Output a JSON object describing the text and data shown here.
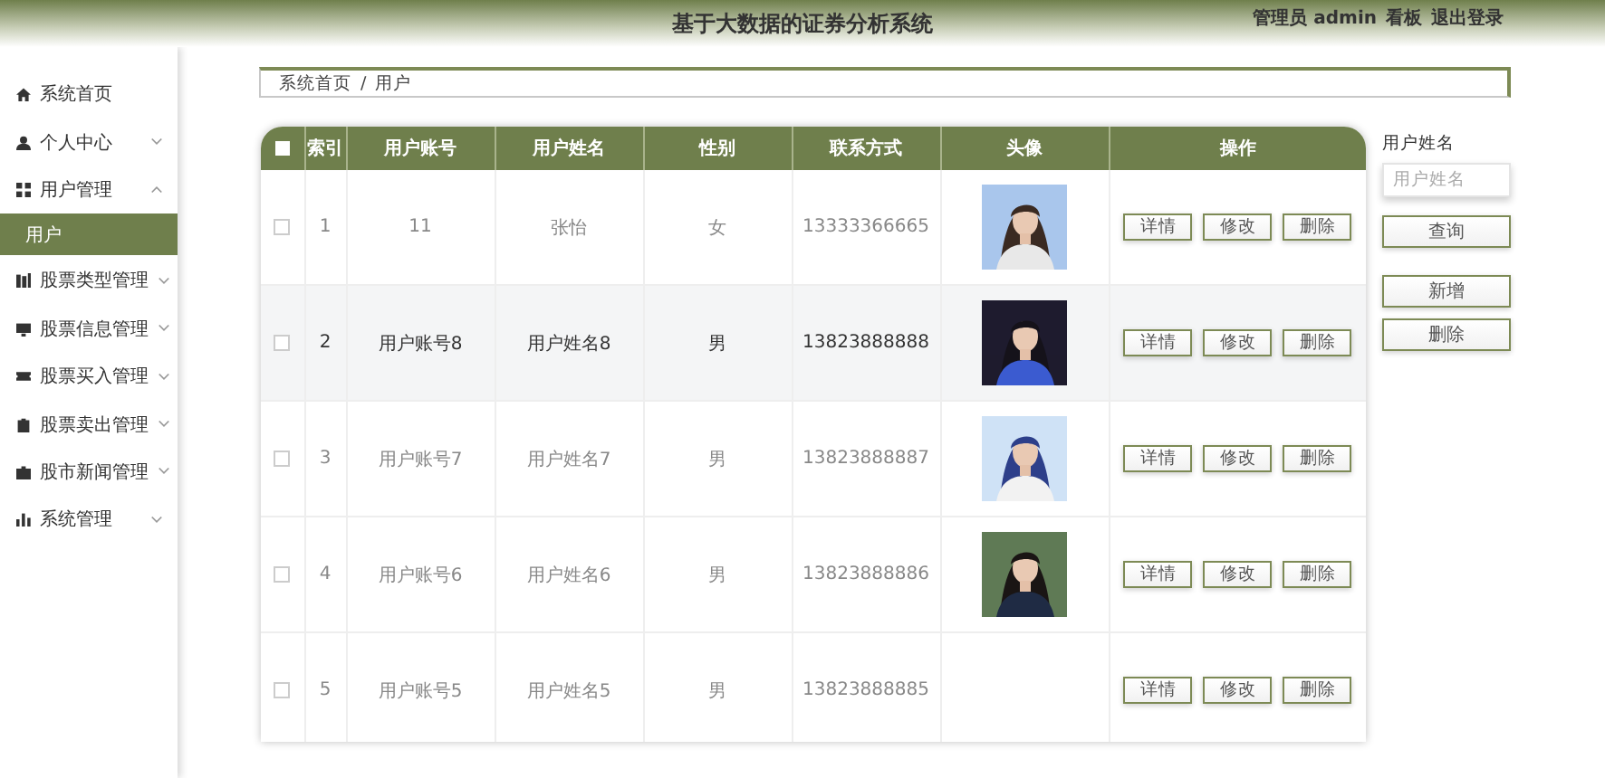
{
  "header": {
    "title": "基于大数据的证券分析系统",
    "links": [
      "管理员 admin",
      "看板",
      "退出登录"
    ]
  },
  "sidebar": {
    "items": [
      {
        "label": "系统首页",
        "kind": "link"
      },
      {
        "label": "个人中心",
        "kind": "group",
        "expanded": false
      },
      {
        "label": "用户管理",
        "kind": "group",
        "expanded": true,
        "children": [
          {
            "label": "用户",
            "selected": true
          }
        ]
      },
      {
        "label": "股票类型管理",
        "kind": "group",
        "expanded": false
      },
      {
        "label": "股票信息管理",
        "kind": "group",
        "expanded": false
      },
      {
        "label": "股票买入管理",
        "kind": "group",
        "expanded": false
      },
      {
        "label": "股票卖出管理",
        "kind": "group",
        "expanded": false
      },
      {
        "label": "股市新闻管理",
        "kind": "group",
        "expanded": false
      },
      {
        "label": "系统管理",
        "kind": "group",
        "expanded": false
      }
    ]
  },
  "breadcrumb": [
    "系统首页",
    "/",
    "用户"
  ],
  "table": {
    "header_checked": false,
    "columns": [
      "索引",
      "用户账号",
      "用户姓名",
      "性别",
      "联系方式",
      "头像",
      "操作"
    ],
    "rows": [
      {
        "checked": false,
        "hovered": false,
        "cells": [
          "1",
          "11",
          "张怡",
          "女",
          "13333366665"
        ],
        "actions": [
          "详情",
          "修改",
          "删除"
        ]
      },
      {
        "checked": false,
        "hovered": true,
        "cells": [
          "2",
          "用户账号8",
          "用户姓名8",
          "男",
          "13823888888"
        ],
        "actions": [
          "详情",
          "修改",
          "删除"
        ]
      },
      {
        "checked": false,
        "hovered": false,
        "cells": [
          "3",
          "用户账号7",
          "用户姓名7",
          "男",
          "13823888887"
        ],
        "actions": [
          "详情",
          "修改",
          "删除"
        ]
      },
      {
        "checked": false,
        "hovered": false,
        "cells": [
          "4",
          "用户账号6",
          "用户姓名6",
          "男",
          "13823888886"
        ],
        "actions": [
          "详情",
          "修改",
          "删除"
        ]
      },
      {
        "checked": false,
        "hovered": false,
        "cells": [
          "5",
          "用户账号5",
          "用户姓名5",
          "男",
          "13823888885"
        ],
        "actions": [
          "详情",
          "修改",
          "删除"
        ]
      }
    ]
  },
  "search": {
    "label": "用户姓名",
    "placeholder": "用户姓名",
    "buttons": [
      "查询",
      "新增",
      "删除"
    ]
  }
}
